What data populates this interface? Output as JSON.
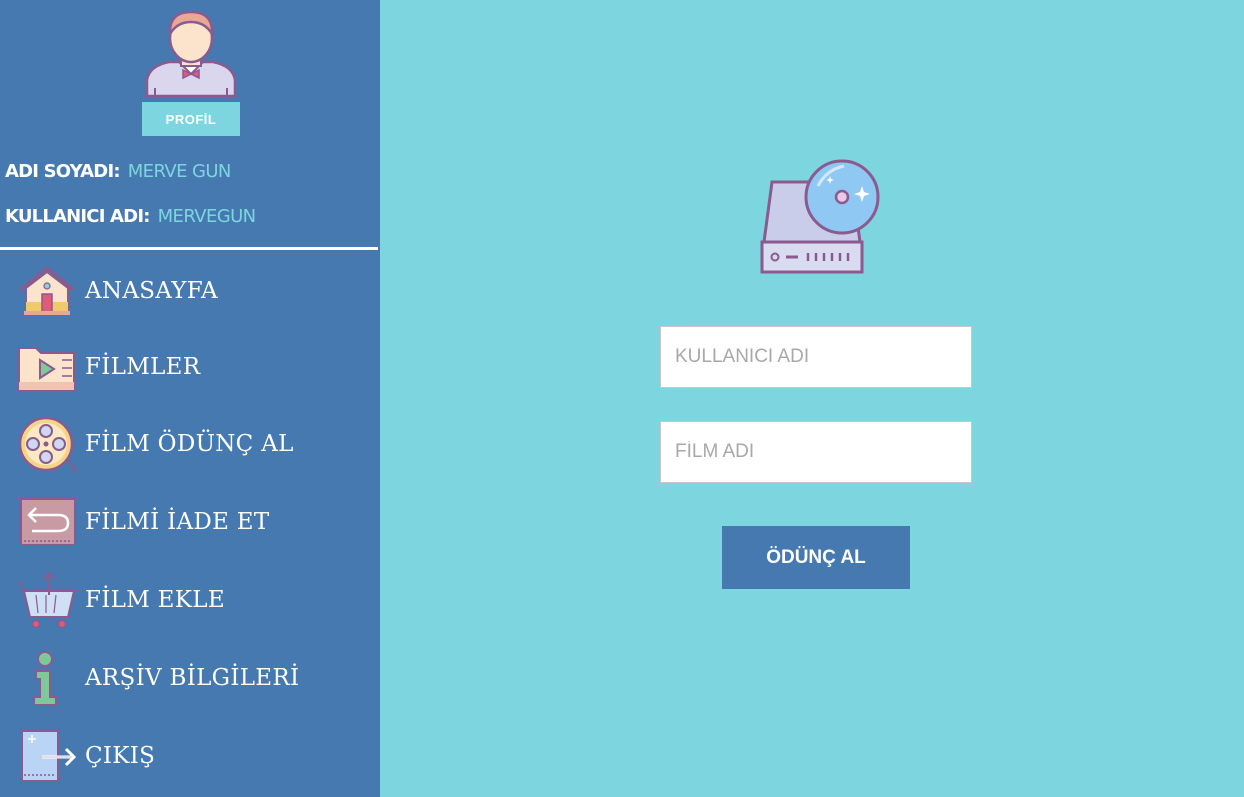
{
  "profile": {
    "button_label": "PROFİL",
    "name_label": "ADI SOYADI:",
    "name_value": "MERVE GUN",
    "username_label": "KULLANICI ADI:",
    "username_value": "MERVEGUN"
  },
  "nav": {
    "items": [
      {
        "label": "ANASAYFA",
        "icon": "house-icon"
      },
      {
        "label": "FİLMLER",
        "icon": "video-folder-icon"
      },
      {
        "label": "FİLM ÖDÜNÇ AL",
        "icon": "film-reel-icon"
      },
      {
        "label": "FİLMİ İADE ET",
        "icon": "return-arrow-icon"
      },
      {
        "label": "FİLM EKLE",
        "icon": "basket-add-icon"
      },
      {
        "label": "ARŞİV BİLGİLERİ",
        "icon": "info-icon"
      },
      {
        "label": "ÇIKIŞ",
        "icon": "exit-door-icon"
      }
    ]
  },
  "form": {
    "icon": "disc-drive-icon",
    "username_placeholder": "KULLANICI ADI",
    "film_placeholder": "FİLM ADI",
    "submit_label": "ÖDÜNÇ AL"
  },
  "colors": {
    "sidebar": "#4679b0",
    "accent": "#7dd6df",
    "text_light": "#ffffff"
  }
}
